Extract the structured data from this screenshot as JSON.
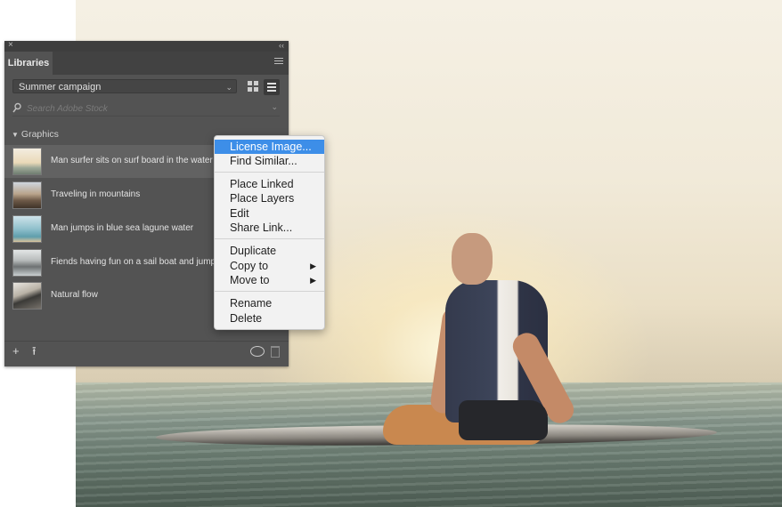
{
  "panel": {
    "close_glyph": "×",
    "collapse_glyph": "‹‹",
    "tab_label": "Libraries",
    "library_name": "Summer campaign",
    "search_placeholder": "Search Adobe Stock",
    "section_title": "Graphics",
    "items": [
      {
        "label": "Man surfer sits on surf board in the water a",
        "selected": true
      },
      {
        "label": "Traveling in mountains",
        "selected": false
      },
      {
        "label": "Man jumps in blue sea lagune water",
        "selected": false
      },
      {
        "label": "Fiends having fun on a sail boat and jump in",
        "selected": false
      },
      {
        "label": "Natural flow",
        "selected": false
      }
    ],
    "footer_add": "+",
    "footer_upload": "⭱"
  },
  "context_menu": {
    "groups": [
      [
        {
          "label": "License Image...",
          "active": true
        },
        {
          "label": "Find Similar..."
        }
      ],
      [
        {
          "label": "Place Linked"
        },
        {
          "label": "Place Layers"
        },
        {
          "label": "Edit"
        },
        {
          "label": "Share Link..."
        }
      ],
      [
        {
          "label": "Duplicate"
        },
        {
          "label": "Copy to",
          "submenu": true
        },
        {
          "label": "Move to",
          "submenu": true
        }
      ],
      [
        {
          "label": "Rename"
        },
        {
          "label": "Delete"
        }
      ]
    ]
  },
  "icons": {
    "view_grid": "grid-view-icon",
    "view_list": "list-view-icon",
    "search": "search-icon",
    "add": "plus-icon",
    "upload": "upload-icon",
    "sync": "creative-cloud-sync-icon",
    "trash": "trash-icon"
  },
  "colors": {
    "panel_bg": "#535353",
    "menu_highlight": "#3d8ee8"
  }
}
